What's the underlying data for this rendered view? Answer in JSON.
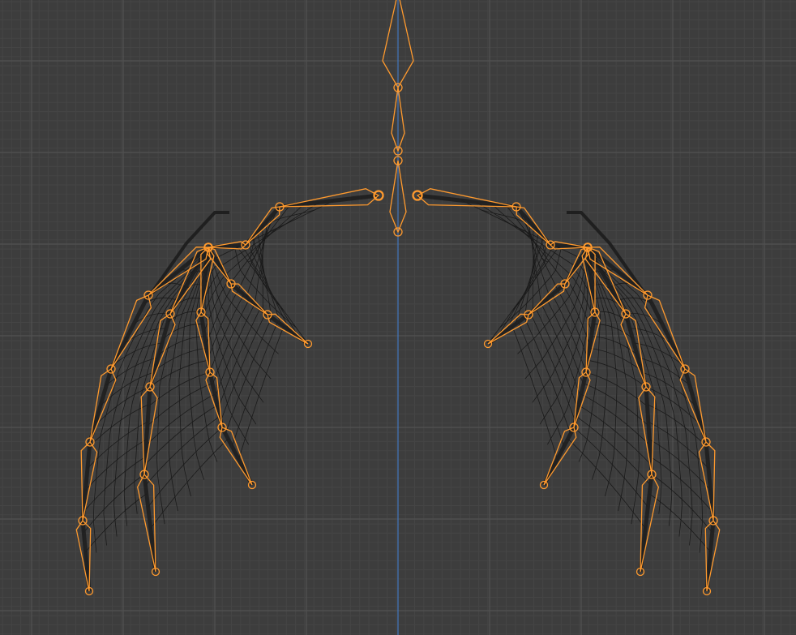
{
  "viewport": {
    "background": "#3d3d3d",
    "grid_minor_color": "#454545",
    "grid_major_color": "#525252",
    "axis_color": "#3f7fd6",
    "mesh_color": "#141414",
    "armature_color": "#ff9a2e",
    "icons": [
      "mesh-wireframe",
      "armature-bones",
      "bone-joint"
    ]
  }
}
